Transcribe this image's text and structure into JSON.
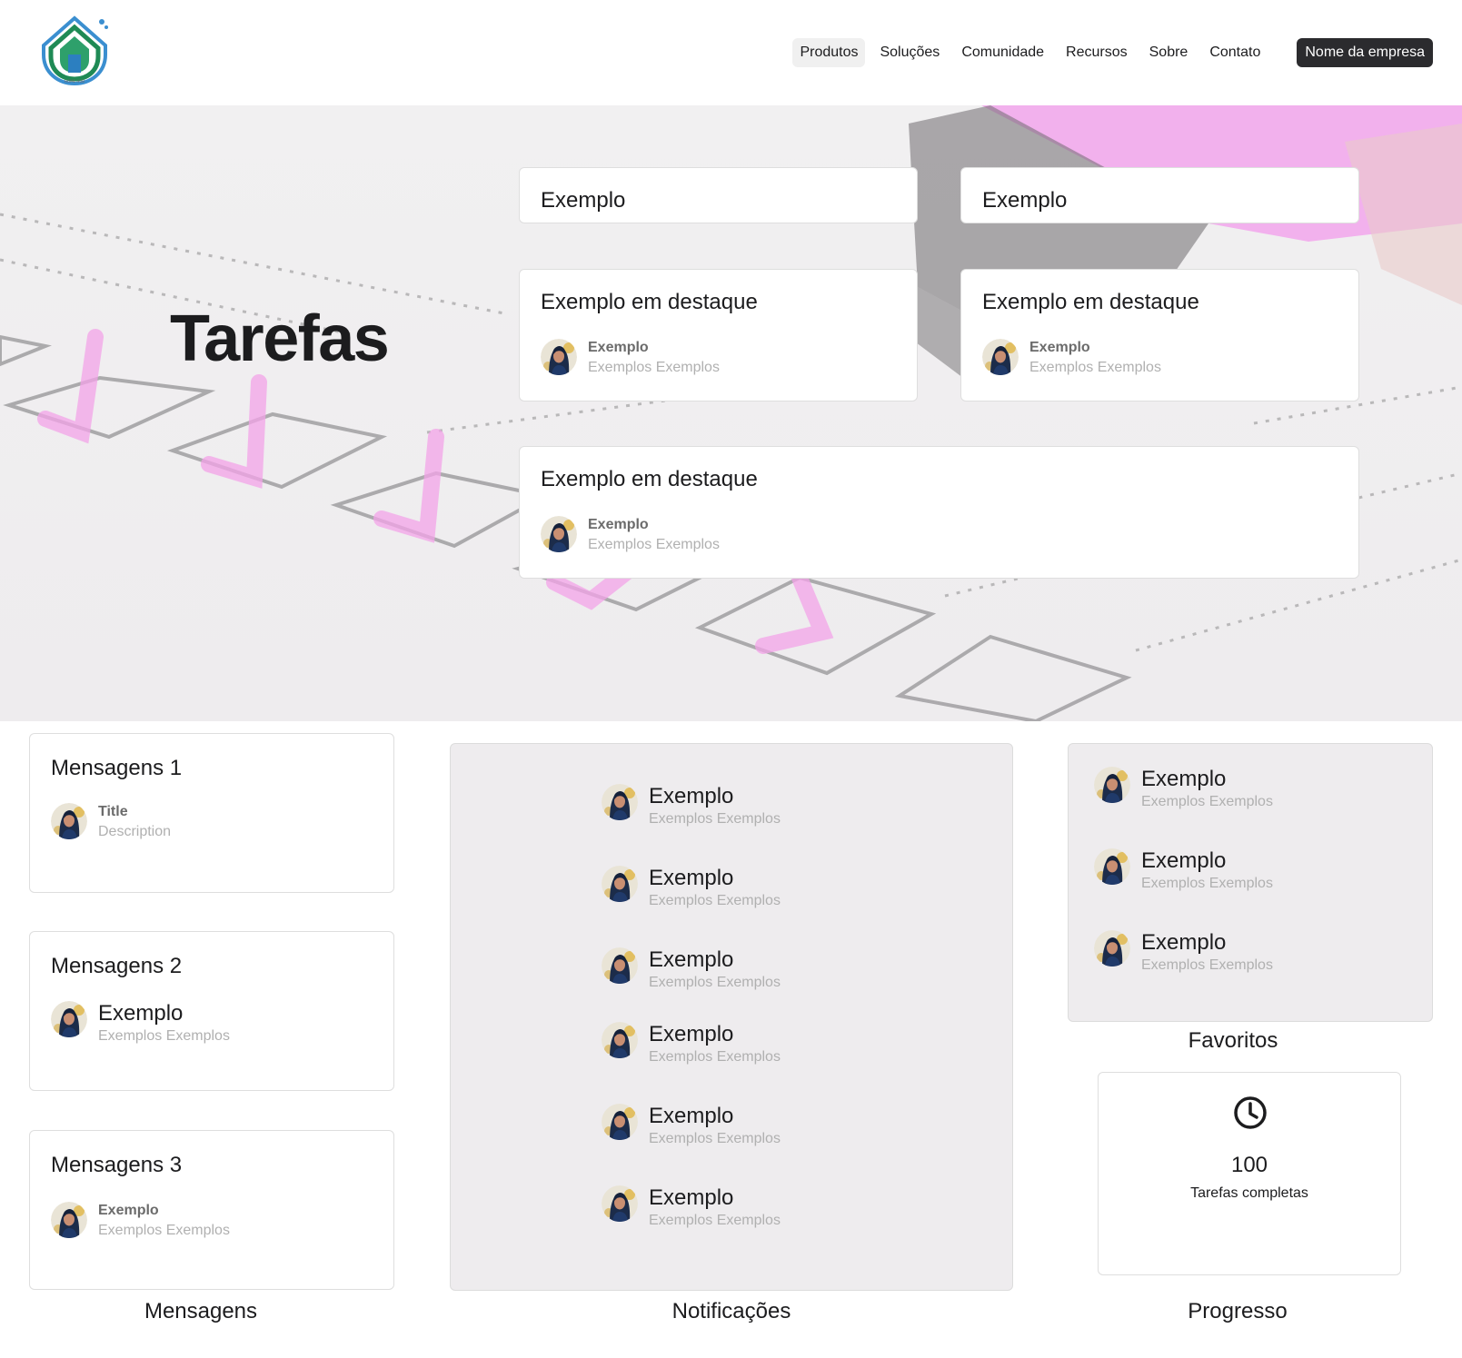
{
  "header": {
    "nav": [
      {
        "label": "Produtos",
        "active": true
      },
      {
        "label": "Soluções"
      },
      {
        "label": "Comunidade"
      },
      {
        "label": "Recursos"
      },
      {
        "label": "Sobre"
      },
      {
        "label": "Contato"
      }
    ],
    "cta_label": "Nome da empresa"
  },
  "hero": {
    "title": "Tarefas",
    "small_cards": [
      {
        "title": "Exemplo"
      },
      {
        "title": "Exemplo"
      }
    ],
    "featured_cards": [
      {
        "title": "Exemplo em destaque",
        "person_name": "Exemplo",
        "person_desc": "Exemplos Exemplos"
      },
      {
        "title": "Exemplo em destaque",
        "person_name": "Exemplo",
        "person_desc": "Exemplos Exemplos"
      },
      {
        "title": "Exemplo em destaque",
        "person_name": "Exemplo",
        "person_desc": "Exemplos Exemplos"
      }
    ]
  },
  "messages": {
    "section_label": "Mensagens",
    "cards": [
      {
        "title": "Mensagens 1",
        "person_name": "Title",
        "person_desc": "Description"
      },
      {
        "title": "Mensagens 2",
        "person_name": "Exemplo",
        "person_desc": "Exemplos Exemplos"
      },
      {
        "title": "Mensagens 3",
        "person_name": "Exemplo",
        "person_desc": "Exemplos Exemplos"
      }
    ]
  },
  "notifications": {
    "section_label": "Notificações",
    "items": [
      {
        "name": "Exemplo",
        "desc": "Exemplos Exemplos"
      },
      {
        "name": "Exemplo",
        "desc": "Exemplos Exemplos"
      },
      {
        "name": "Exemplo",
        "desc": "Exemplos Exemplos"
      },
      {
        "name": "Exemplo",
        "desc": "Exemplos Exemplos"
      },
      {
        "name": "Exemplo",
        "desc": "Exemplos Exemplos"
      },
      {
        "name": "Exemplo",
        "desc": "Exemplos Exemplos"
      }
    ]
  },
  "favorites": {
    "section_label": "Favoritos",
    "items": [
      {
        "name": "Exemplo",
        "desc": "Exemplos Exemplos"
      },
      {
        "name": "Exemplo",
        "desc": "Exemplos Exemplos"
      },
      {
        "name": "Exemplo",
        "desc": "Exemplos Exemplos"
      }
    ]
  },
  "progress": {
    "section_label": "Progresso",
    "icon": "clock-icon",
    "value": "100",
    "caption": "Tarefas completas"
  },
  "colors": {
    "accent_pink": "#f08ee6",
    "dark_button": "#2b2b2e",
    "panel_gray": "#eeecee"
  }
}
